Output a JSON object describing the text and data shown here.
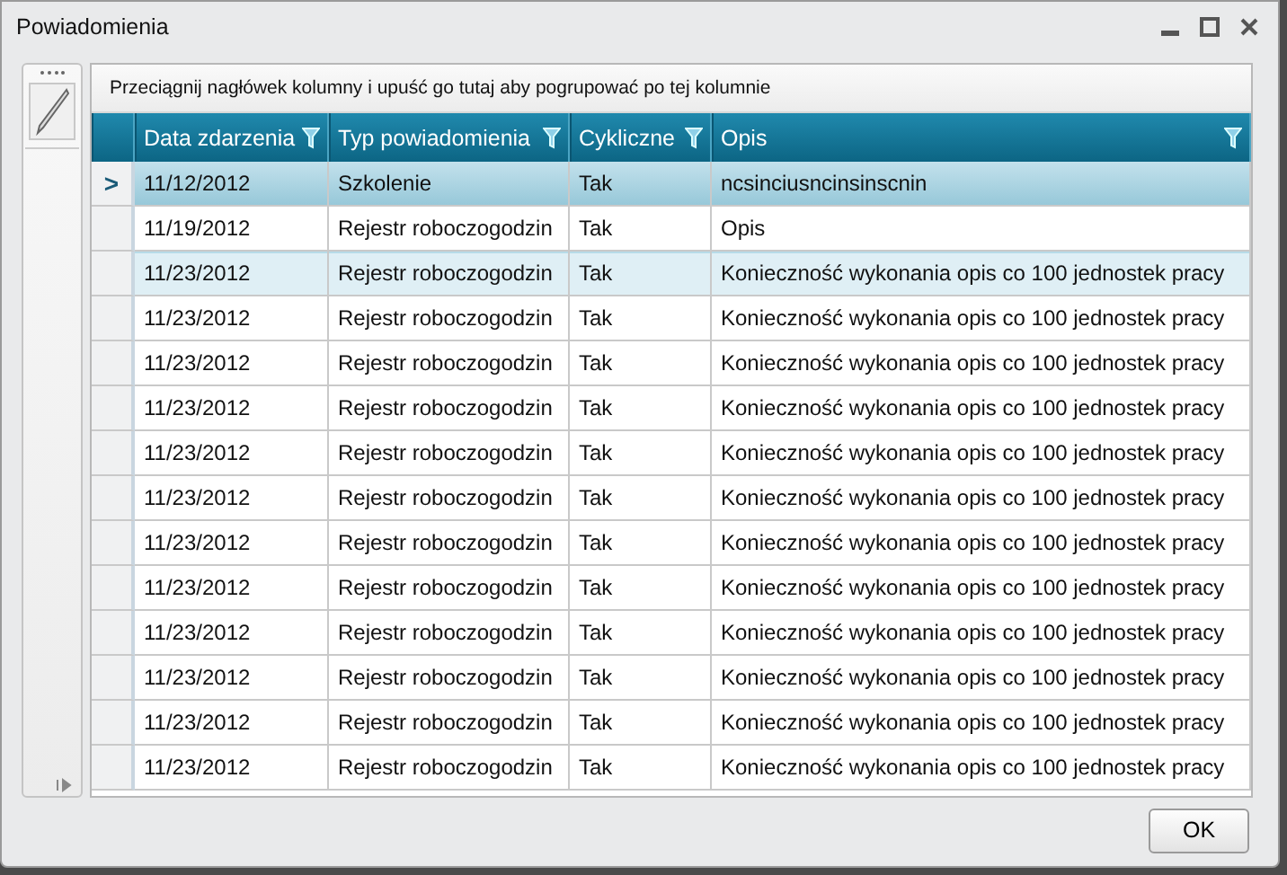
{
  "window": {
    "title": "Powiadomienia"
  },
  "group_panel": {
    "hint": "Przeciągnij nagłówek kolumny i upuść go tutaj aby pogrupować po tej kolumnie"
  },
  "table": {
    "columns": [
      {
        "label": "Data zdarzenia"
      },
      {
        "label": "Typ powiadomienia"
      },
      {
        "label": "Cykliczne"
      },
      {
        "label": "Opis"
      }
    ],
    "current_row_marker": ">",
    "rows": [
      {
        "selected": true,
        "hovered": false,
        "cells": [
          "11/12/2012",
          "Szkolenie",
          "Tak",
          "ncsinciusncinsinscnin"
        ]
      },
      {
        "selected": false,
        "hovered": false,
        "cells": [
          "11/19/2012",
          "Rejestr roboczogodzin",
          "Tak",
          "Opis"
        ]
      },
      {
        "selected": false,
        "hovered": true,
        "cells": [
          "11/23/2012",
          "Rejestr roboczogodzin",
          "Tak",
          "Konieczność wykonania opis co 100 jednostek pracy"
        ]
      },
      {
        "selected": false,
        "hovered": false,
        "cells": [
          "11/23/2012",
          "Rejestr roboczogodzin",
          "Tak",
          "Konieczność wykonania opis co 100 jednostek pracy"
        ]
      },
      {
        "selected": false,
        "hovered": false,
        "cells": [
          "11/23/2012",
          "Rejestr roboczogodzin",
          "Tak",
          "Konieczność wykonania opis co 100 jednostek pracy"
        ]
      },
      {
        "selected": false,
        "hovered": false,
        "cells": [
          "11/23/2012",
          "Rejestr roboczogodzin",
          "Tak",
          "Konieczność wykonania opis co 100 jednostek pracy"
        ]
      },
      {
        "selected": false,
        "hovered": false,
        "cells": [
          "11/23/2012",
          "Rejestr roboczogodzin",
          "Tak",
          "Konieczność wykonania opis co 100 jednostek pracy"
        ]
      },
      {
        "selected": false,
        "hovered": false,
        "cells": [
          "11/23/2012",
          "Rejestr roboczogodzin",
          "Tak",
          "Konieczność wykonania opis co 100 jednostek pracy"
        ]
      },
      {
        "selected": false,
        "hovered": false,
        "cells": [
          "11/23/2012",
          "Rejestr roboczogodzin",
          "Tak",
          "Konieczność wykonania opis co 100 jednostek pracy"
        ]
      },
      {
        "selected": false,
        "hovered": false,
        "cells": [
          "11/23/2012",
          "Rejestr roboczogodzin",
          "Tak",
          "Konieczność wykonania opis co 100 jednostek pracy"
        ]
      },
      {
        "selected": false,
        "hovered": false,
        "cells": [
          "11/23/2012",
          "Rejestr roboczogodzin",
          "Tak",
          "Konieczność wykonania opis co 100 jednostek pracy"
        ]
      },
      {
        "selected": false,
        "hovered": false,
        "cells": [
          "11/23/2012",
          "Rejestr roboczogodzin",
          "Tak",
          "Konieczność wykonania opis co 100 jednostek pracy"
        ]
      },
      {
        "selected": false,
        "hovered": false,
        "cells": [
          "11/23/2012",
          "Rejestr roboczogodzin",
          "Tak",
          "Konieczność wykonania opis co 100 jednostek pracy"
        ]
      },
      {
        "selected": false,
        "hovered": false,
        "cells": [
          "11/23/2012",
          "Rejestr roboczogodzin",
          "Tak",
          "Konieczność wykonania opis co 100 jednostek pracy"
        ]
      }
    ]
  },
  "buttons": [
    {
      "label": "OK"
    }
  ]
}
